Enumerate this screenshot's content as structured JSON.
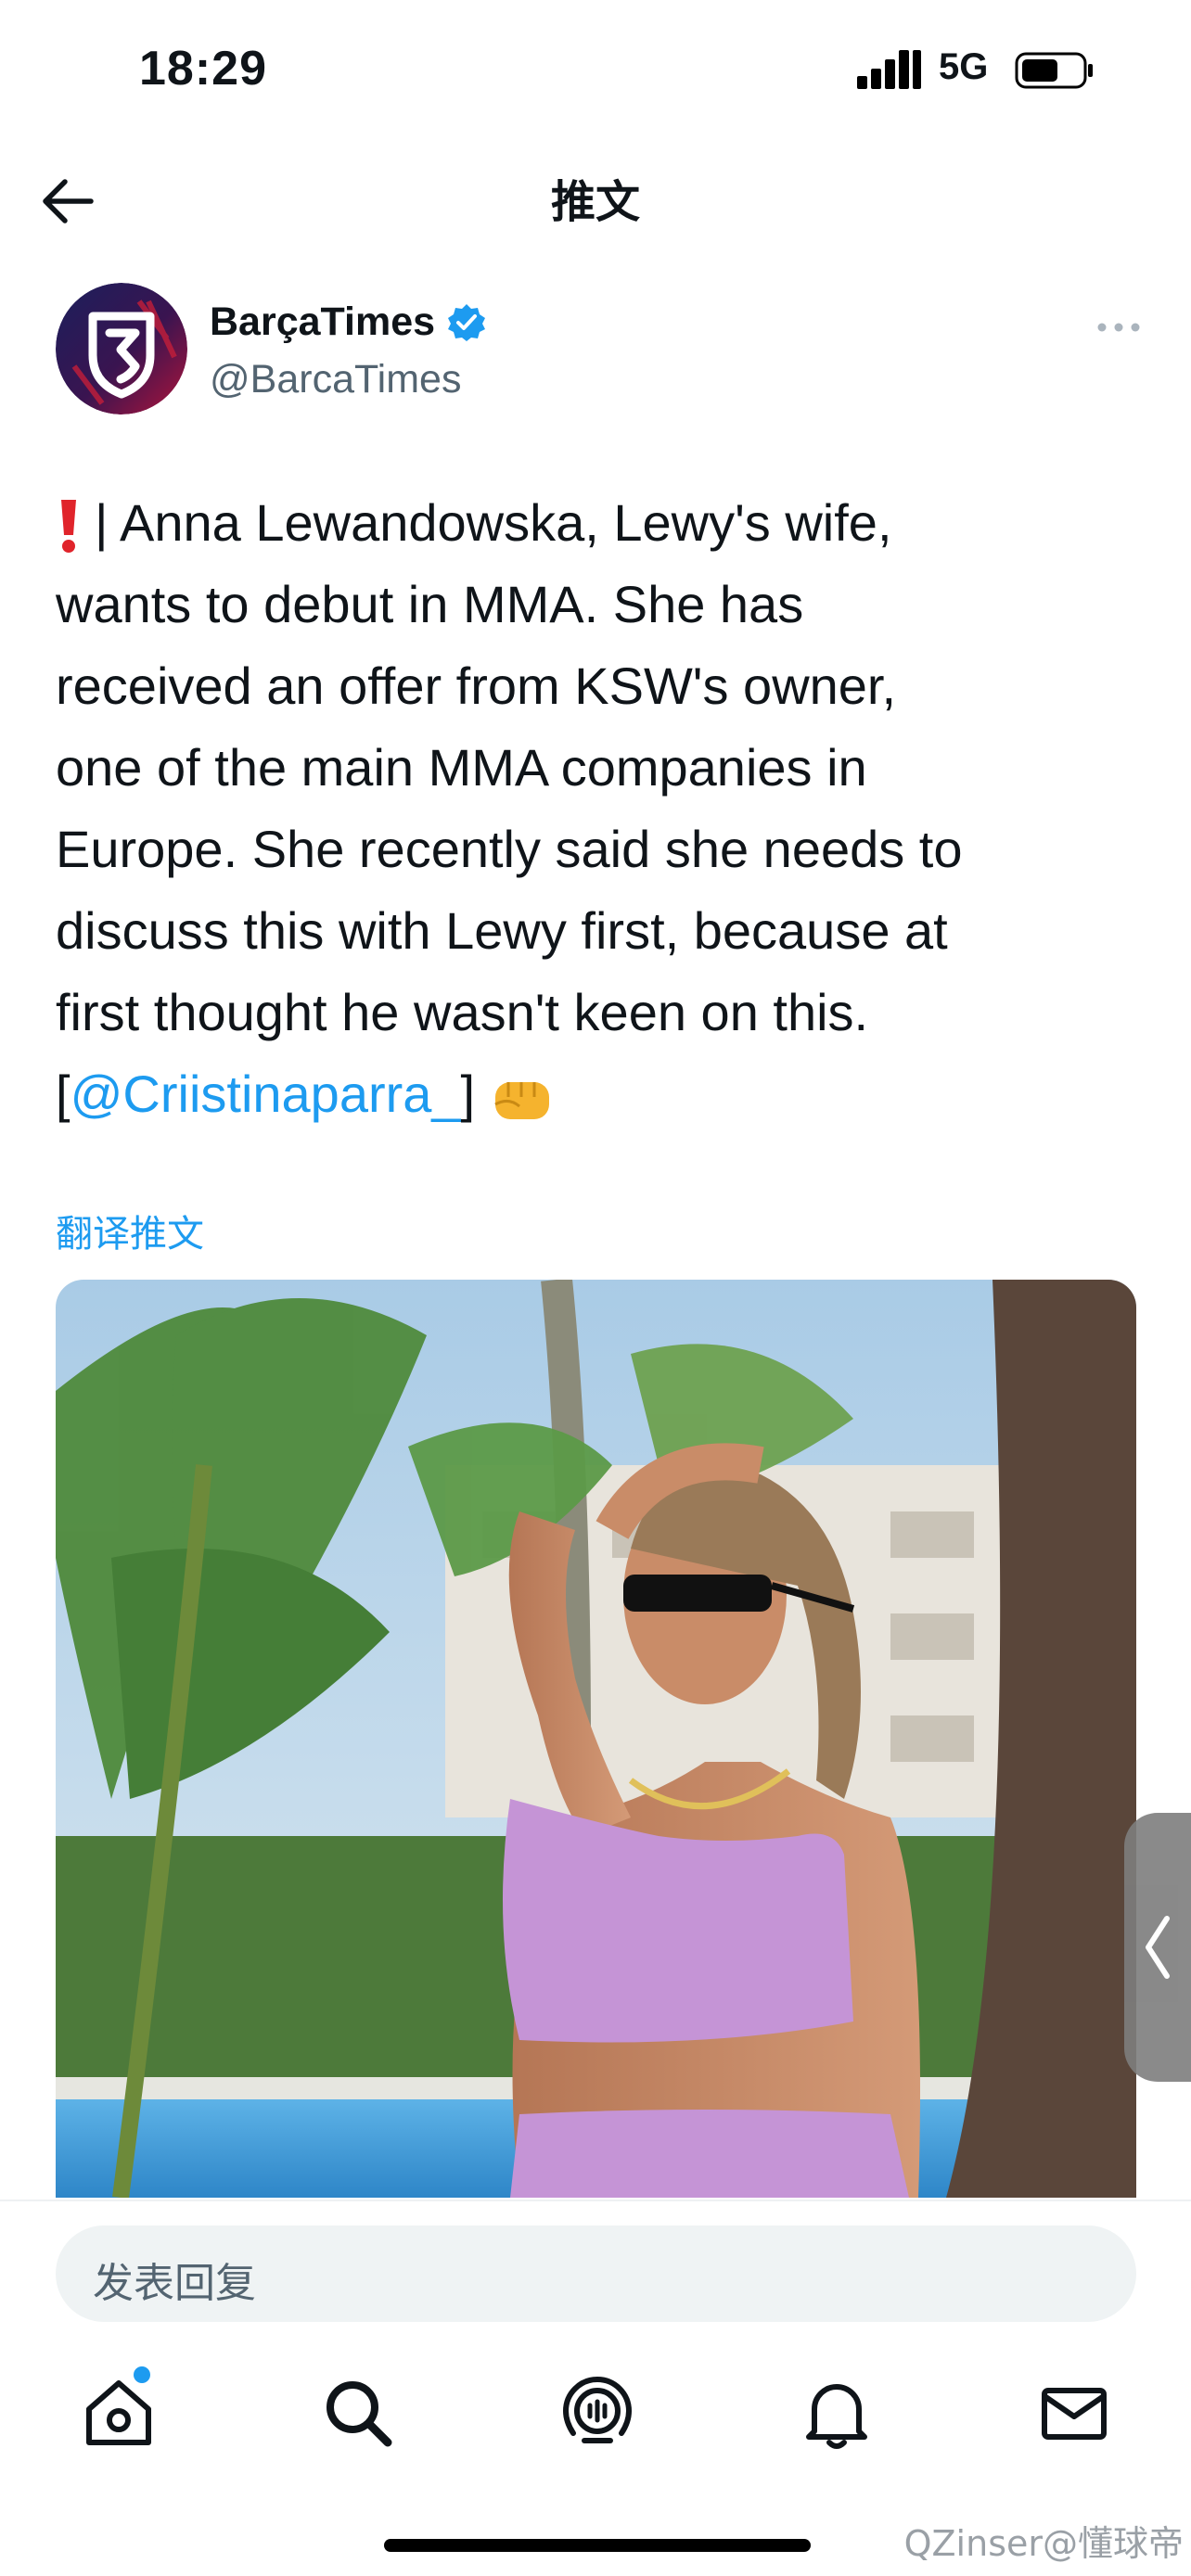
{
  "status_bar": {
    "time": "18:29",
    "network": "5G"
  },
  "nav": {
    "title": "推文"
  },
  "tweet": {
    "display_name": "BarçaTimes",
    "handle": "@BarcaTimes",
    "text_lines": [
      "| Anna Lewandowska, Lewy's wife,",
      "wants to debut in MMA. She has",
      "received an offer from KSW's owner,",
      "one of the main MMA companies in",
      "Europe. She recently said she needs to",
      "discuss this with Lewy first, because at",
      "first thought he wasn't keen on this."
    ],
    "credit_open": "[",
    "mention": "@Criistinaparra_",
    "credit_close": "]",
    "translate_label": "翻译推文"
  },
  "reply": {
    "placeholder": "发表回复"
  },
  "tabs": [
    "home",
    "search",
    "spaces",
    "notifications",
    "messages"
  ],
  "watermark": "QZinser@懂球帝",
  "colors": {
    "accent": "#1d9bf0",
    "text": "#0f1419",
    "muted": "#536471"
  }
}
